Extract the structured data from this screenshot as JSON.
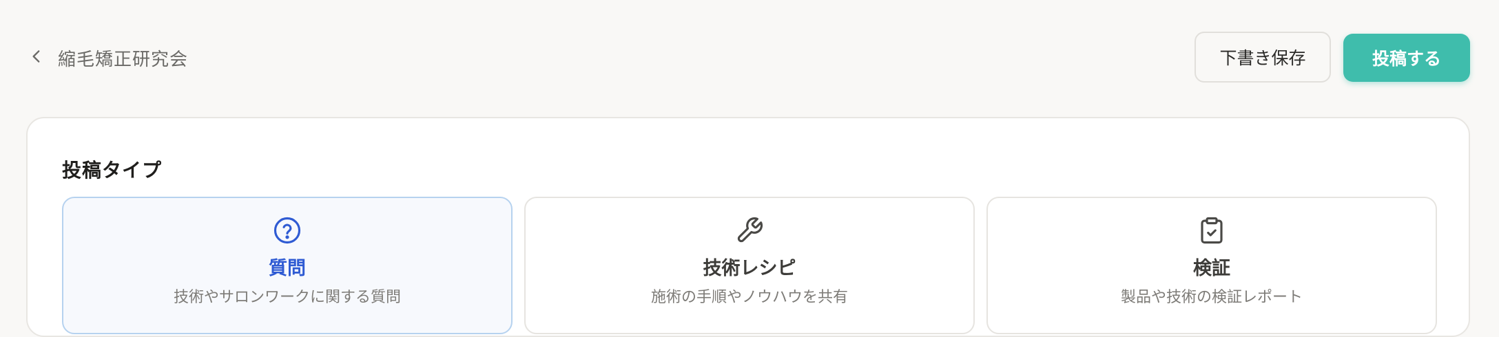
{
  "header": {
    "back_label": "縮毛矯正研究会",
    "draft_label": "下書き保存",
    "post_label": "投稿する"
  },
  "post_type": {
    "title": "投稿タイプ",
    "selected": "question",
    "options": [
      {
        "id": "question",
        "icon": "question-circle-icon",
        "title": "質問",
        "description": "技術やサロンワークに関する質問"
      },
      {
        "id": "recipe",
        "icon": "wrench-icon",
        "title": "技術レシピ",
        "description": "施術の手順やノウハウを共有"
      },
      {
        "id": "verification",
        "icon": "clipboard-check-icon",
        "title": "検証",
        "description": "製品や技術の検証レポート"
      }
    ]
  },
  "colors": {
    "accent": "#3fbdac",
    "selected_text": "#2f5bd3",
    "selected_border": "#b6d2ef",
    "background": "#f9f8f6"
  }
}
